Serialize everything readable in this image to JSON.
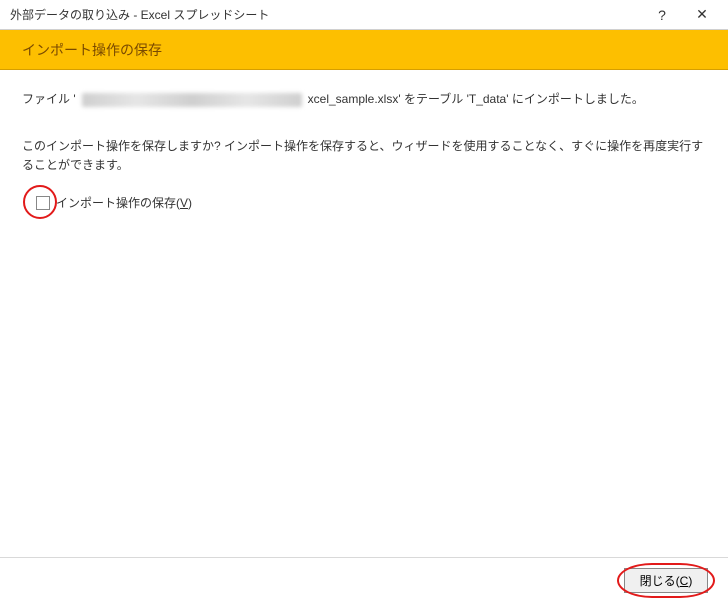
{
  "titlebar": {
    "title": "外部データの取り込み - Excel スプレッドシート",
    "help": "?",
    "close": "✕"
  },
  "header": {
    "title": "インポート操作の保存"
  },
  "content": {
    "file_prefix": "ファイル '",
    "file_suffix": "xcel_sample.xlsx' をテーブル 'T_data' にインポートしました。",
    "prompt": "このインポート操作を保存しますか? インポート操作を保存すると、ウィザードを使用することなく、すぐに操作を再度実行することができます。",
    "checkbox_label_prefix": "インポート操作の保存(",
    "checkbox_accel": "V",
    "checkbox_label_suffix": ")"
  },
  "footer": {
    "close_prefix": "閉じる(",
    "close_accel": "C",
    "close_suffix": ")"
  }
}
